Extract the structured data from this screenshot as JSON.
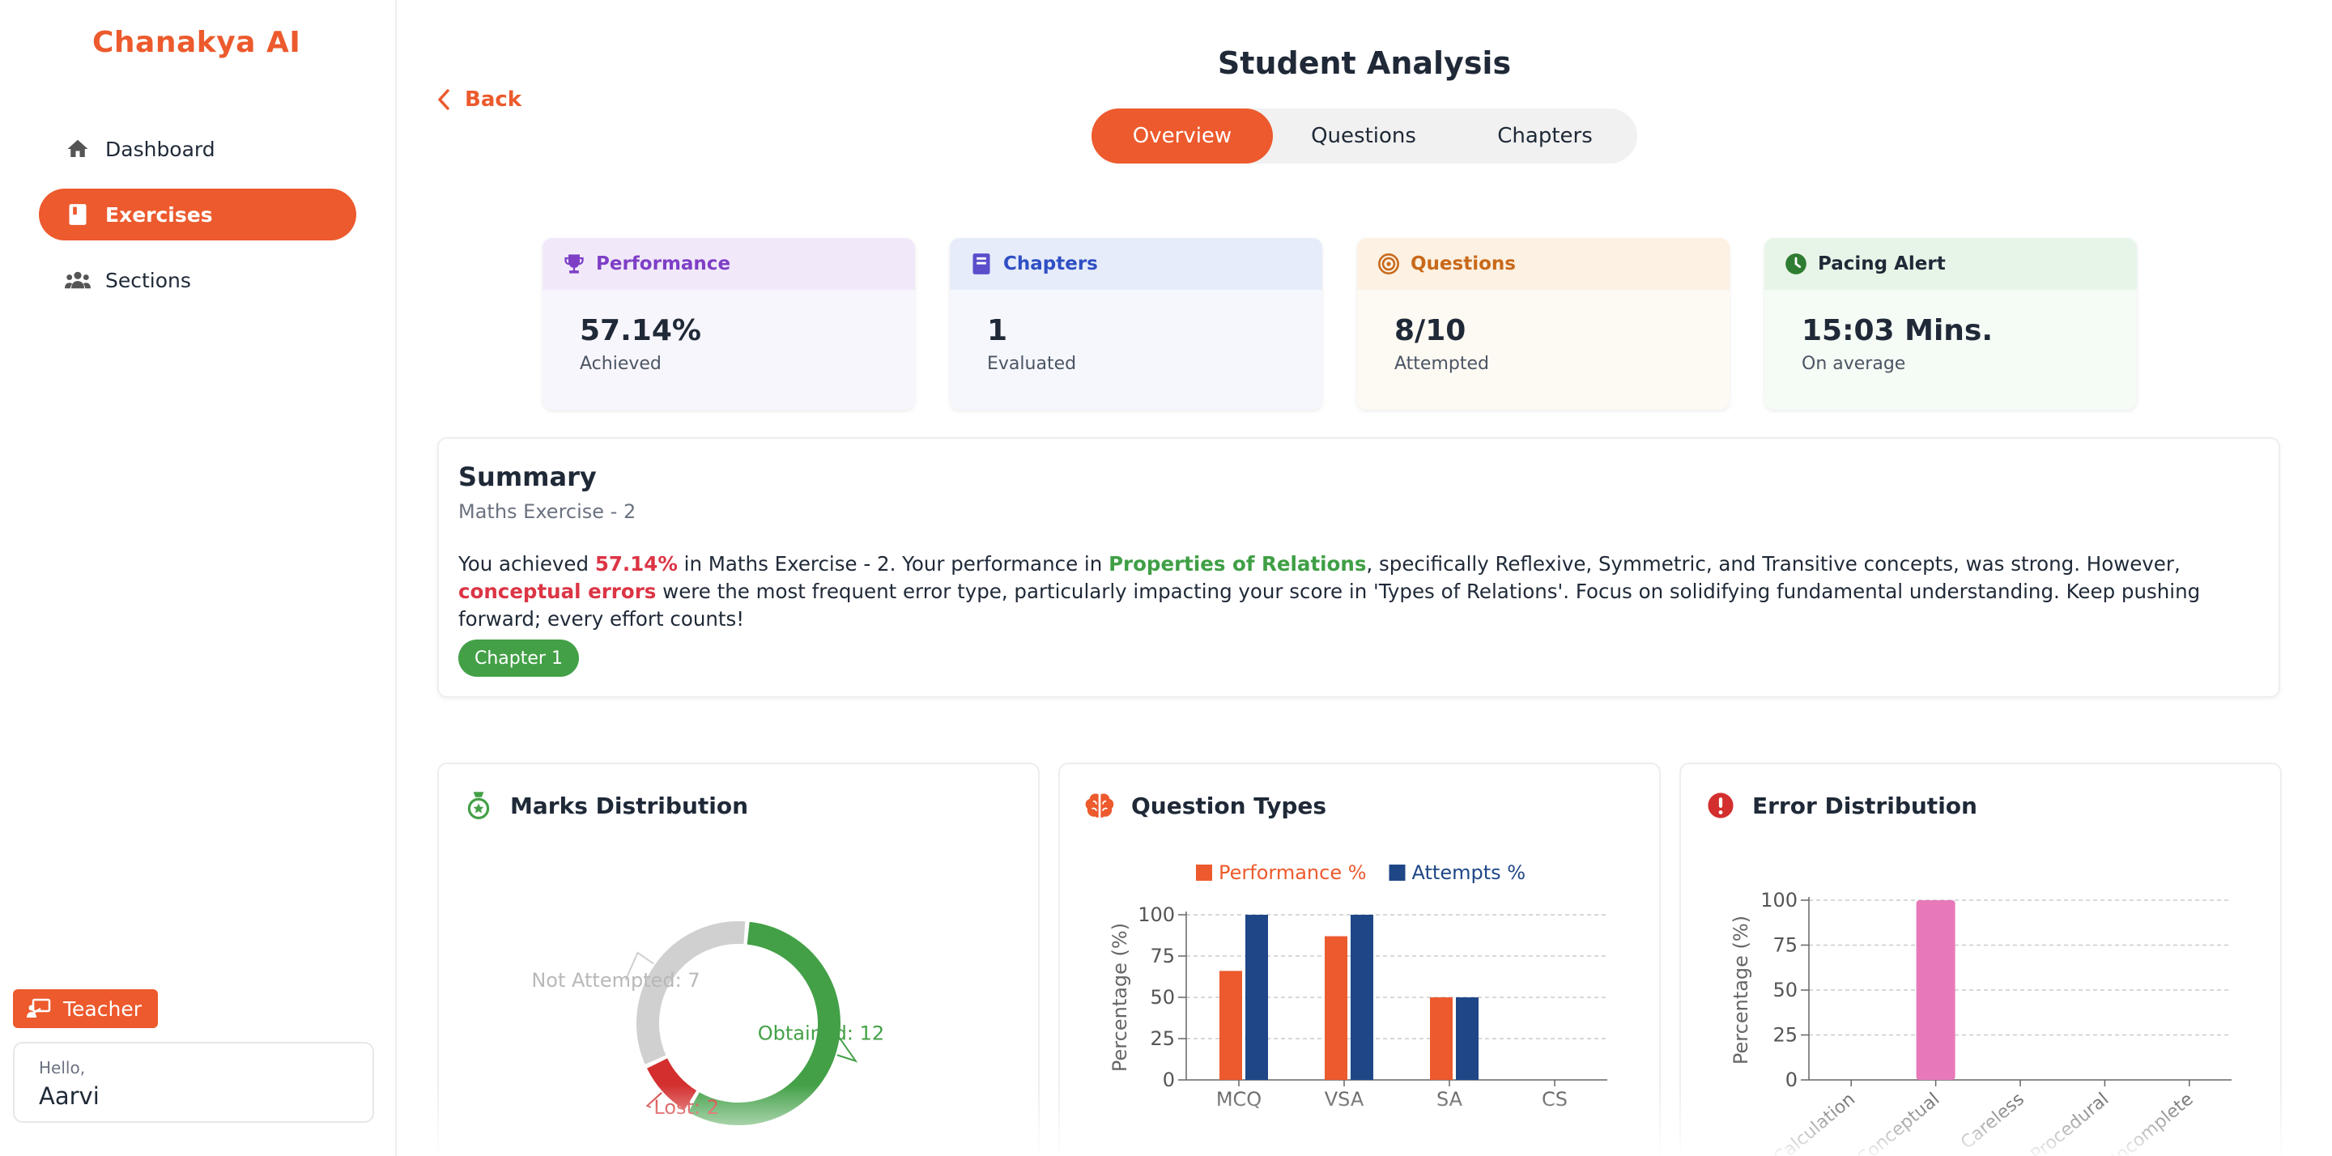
{
  "app": {
    "logo": "Chanakya AI"
  },
  "sidebar": {
    "items": [
      {
        "label": "Dashboard",
        "icon": "home-icon"
      },
      {
        "label": "Exercises",
        "icon": "book-icon",
        "active": true
      },
      {
        "label": "Sections",
        "icon": "users-icon"
      }
    ],
    "role_label": "Teacher",
    "user": {
      "greeting": "Hello,",
      "name": "Aarvi"
    }
  },
  "header": {
    "back_label": "Back",
    "title": "Student Analysis",
    "tabs": [
      {
        "label": "Overview",
        "active": true
      },
      {
        "label": "Questions"
      },
      {
        "label": "Chapters"
      }
    ]
  },
  "stats": [
    {
      "title": "Performance",
      "value": "57.14%",
      "sub": "Achieved",
      "icon": "trophy-icon",
      "accent": "#7e3fc6",
      "head_bg": "#f1e9fa",
      "body_bg": "#f8f6fd"
    },
    {
      "title": "Chapters",
      "value": "1",
      "sub": "Evaluated",
      "icon": "book-icon",
      "accent": "#2f4fc4",
      "head_bg": "#e6ecfa",
      "body_bg": "#f5f7fd"
    },
    {
      "title": "Questions",
      "value": "8/10",
      "sub": "Attempted",
      "icon": "target-icon",
      "accent": "#c9691a",
      "head_bg": "#fcf1e2",
      "body_bg": "#fdf9f3"
    },
    {
      "title": "Pacing Alert",
      "value": "15:03 Mins.",
      "sub": "On average",
      "icon": "clock-icon",
      "accent": "#2e7d32",
      "head_bg": "#e7f5e8",
      "body_bg": "#f5fbf5"
    }
  ],
  "summary": {
    "title": "Summary",
    "subtitle": "Maths Exercise - 2",
    "text_1": "You achieved ",
    "score": "57.14%",
    "text_2": " in Maths Exercise - 2. Your performance in ",
    "strong_topic": "Properties of Relations",
    "text_3": ", specifically Reflexive, Symmetric, and Transitive concepts, was strong. However, ",
    "weak_area": "conceptual errors",
    "text_4": " were the most frequent error type, particularly impacting your score in 'Types of Relations'. Focus on solidifying fundamental understanding. Keep pushing forward; every effort counts!",
    "chip": "Chapter 1"
  },
  "panels": {
    "marks": {
      "title": "Marks Distribution",
      "icon": "medal-icon"
    },
    "types": {
      "title": "Question Types",
      "icon": "brain-icon"
    },
    "errors": {
      "title": "Error Distribution",
      "icon": "alert-icon"
    }
  },
  "chart_data": [
    {
      "type": "pie",
      "categories": [
        "Obtained",
        "Lost",
        "Not Attempted"
      ],
      "values": [
        12,
        2,
        7
      ],
      "labels": [
        "Obtained: 12",
        "Lost: 2",
        "Not Attempted: 7"
      ],
      "colors": [
        "#43a047",
        "#d32f2f",
        "#d0d0d0"
      ]
    },
    {
      "type": "bar",
      "categories": [
        "MCQ",
        "VSA",
        "SA",
        "CS"
      ],
      "series": [
        {
          "name": "Performance %",
          "values": [
            66,
            87,
            50,
            0
          ],
          "color": "#ec5a2d"
        },
        {
          "name": "Attempts %",
          "values": [
            100,
            100,
            50,
            0
          ],
          "color": "#1f4788"
        }
      ],
      "ylabel": "Percentage (%)",
      "ylim": [
        0,
        100
      ],
      "yticks": [
        "0",
        "25",
        "50",
        "75",
        "100"
      ],
      "legend": "top",
      "grid": true
    },
    {
      "type": "bar",
      "categories": [
        "Calculation",
        "Conceptual",
        "Careless",
        "Procedural",
        "Incomplete"
      ],
      "values": [
        0,
        100,
        0,
        0,
        0
      ],
      "color": "#e879b9",
      "ylabel": "Percentage (%)",
      "ylim": [
        0,
        100
      ],
      "yticks": [
        "0",
        "25",
        "50",
        "75",
        "100"
      ],
      "grid": true
    }
  ]
}
